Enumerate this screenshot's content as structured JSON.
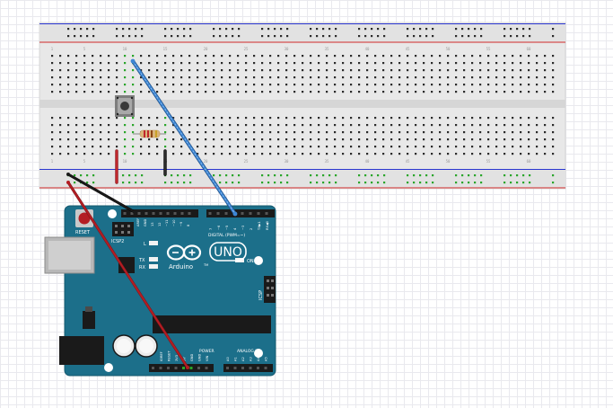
{
  "canvas": {
    "background": "#ffffff",
    "grid_color": "#e4e4ea"
  },
  "breadboard": {
    "body_color": "#e9e9e9",
    "hole_color": "#2b2b2b",
    "connected_hole_color": "#2aa52a",
    "rail_red": "#d02a2a",
    "rail_blue": "#2a36d0",
    "column_numbers": [
      "1",
      "5",
      "10",
      "15",
      "20",
      "25",
      "30",
      "35",
      "40",
      "45",
      "50",
      "55",
      "60"
    ]
  },
  "arduino": {
    "board_color": "#1c6f8a",
    "reset_label": "RESET",
    "icsp2_label": "ICSP2",
    "led_l_label": "L",
    "tx_label": "TX",
    "rx_label": "RX",
    "brand_label": "Arduino",
    "tm_label": "TM",
    "model_label": "UNO",
    "on_label": "ON",
    "icsp_label": "ICSP",
    "digital_label": "DIGITAL (PWM=~)",
    "power_label": "POWER",
    "analog_label": "ANALOG IN",
    "top_header_labels": [
      "AREF",
      "GND",
      "13",
      "12",
      "~11",
      "~10",
      "~9",
      "8"
    ],
    "right_header_labels": [
      "7",
      "~6",
      "~5",
      "4",
      "~3",
      "2",
      "TX▶1",
      "RX◀0"
    ],
    "power_header_labels": [
      "IOREF",
      "RESET",
      "3V3",
      "5V",
      "GND",
      "GND",
      "VIN"
    ],
    "analog_header_labels": [
      "A0",
      "A1",
      "A2",
      "A3",
      "A4",
      "A5"
    ]
  },
  "components": {
    "pushbutton": "pushbutton-4-pin",
    "resistor": "resistor-220-ohm"
  },
  "wires": [
    {
      "name": "red-5v-wire",
      "color": "#c0272d"
    },
    {
      "name": "black-gnd-wire",
      "color": "#1a1a1a"
    },
    {
      "name": "blue-signal-wire",
      "color": "#3d86d4"
    }
  ]
}
